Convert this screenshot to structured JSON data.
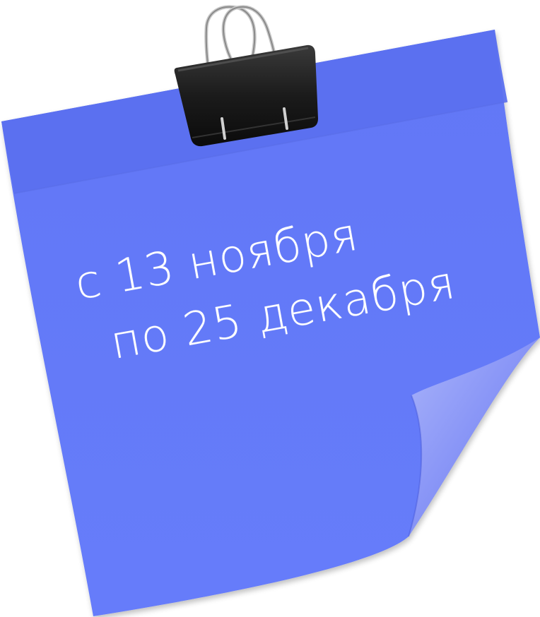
{
  "note": {
    "line1": "с 13 ноября",
    "line2": "по 25 декабря"
  },
  "colors": {
    "note_fill": "#6479f7",
    "note_header": "#5d72f0",
    "note_curl": "#8f9cf8",
    "clip": "#1f1f1f",
    "text": "#ffffff"
  },
  "icons": {
    "clip": "binder-clip-icon"
  }
}
